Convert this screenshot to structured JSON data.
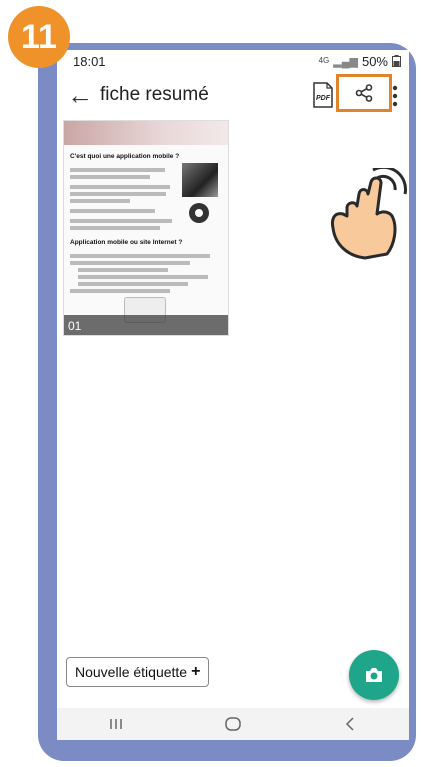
{
  "tutorial": {
    "step_number": "11",
    "accent_color": "#f0922a",
    "frame_color": "#7b8bc4"
  },
  "status_bar": {
    "time": "18:01",
    "network": "4G",
    "battery": "50%"
  },
  "app_bar": {
    "title": "fiche resumé",
    "pdf_icon_text": "PDF"
  },
  "document": {
    "page_number": "01",
    "preview_heading_1": "C'est quoi une application mobile ?",
    "preview_heading_2": "Application mobile ou site Internet ?"
  },
  "bottom": {
    "new_label_text": "Nouvelle étiquette",
    "plus_symbol": "+"
  },
  "colors": {
    "fab": "#1fa58a",
    "highlight": "#e0832a"
  },
  "icons": [
    "back-arrow-icon",
    "pdf-icon",
    "share-icon",
    "more-vert-icon",
    "camera-icon",
    "hand-pointer-icon"
  ]
}
